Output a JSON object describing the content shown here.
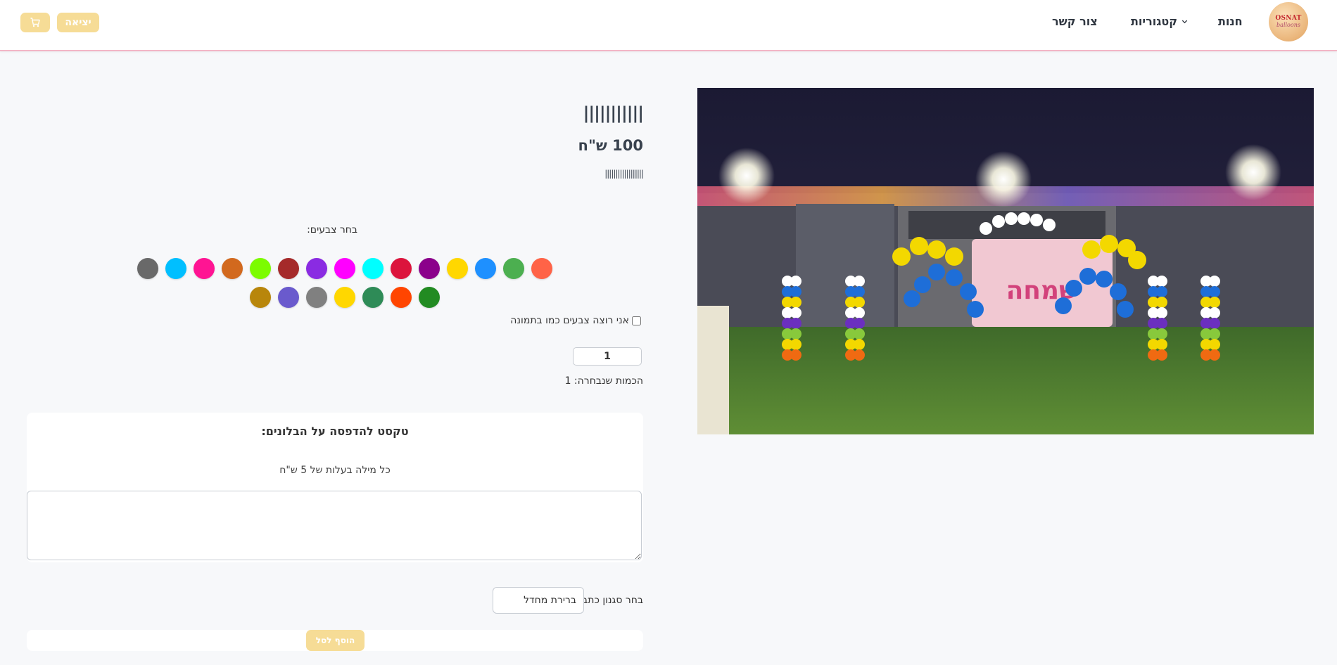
{
  "header": {
    "logo_line1": "OSNAT",
    "logo_line2": "balloons",
    "nav": {
      "shop": "חנות",
      "categories": "קטגוריות",
      "contact": "צור קשר"
    },
    "logout_label": "יציאה",
    "cart_icon": "cart-icon"
  },
  "product": {
    "title": "|||||||||||",
    "price": "100 ש\"ח",
    "description": "||||||||||||||||||"
  },
  "colors": {
    "label": "בחר צבעים:",
    "row1": [
      "#ff6347",
      "#4caf50",
      "#1e90ff",
      "#ffd700",
      "#8b008b",
      "#dc143c",
      "#00ffff",
      "#ff00ff",
      "#8a2be2",
      "#a52a2a",
      "#7cfc00",
      "#d2691e",
      "#ff1493",
      "#00bfff",
      "#696969"
    ],
    "row2": [
      "#228b22",
      "#ff4500",
      "#2e8b57",
      "#ffd700",
      "#808080",
      "#6a5acd",
      "#b8860b"
    ],
    "same_as_image_label": "אני רוצה צבעים כמו בתמונה"
  },
  "quantity": {
    "value": "1",
    "selected_label": "הכמות שנבחרה: 1"
  },
  "print_text": {
    "title": "טקסט להדפסה על הבלונים:",
    "subtitle": "כל מילה בעלות של 5 ש\"ח"
  },
  "font_style": {
    "label": "בחר סגנון כתב:",
    "selected": "ברירת מחדל"
  },
  "add_to_cart_label": "הוסף לסל"
}
